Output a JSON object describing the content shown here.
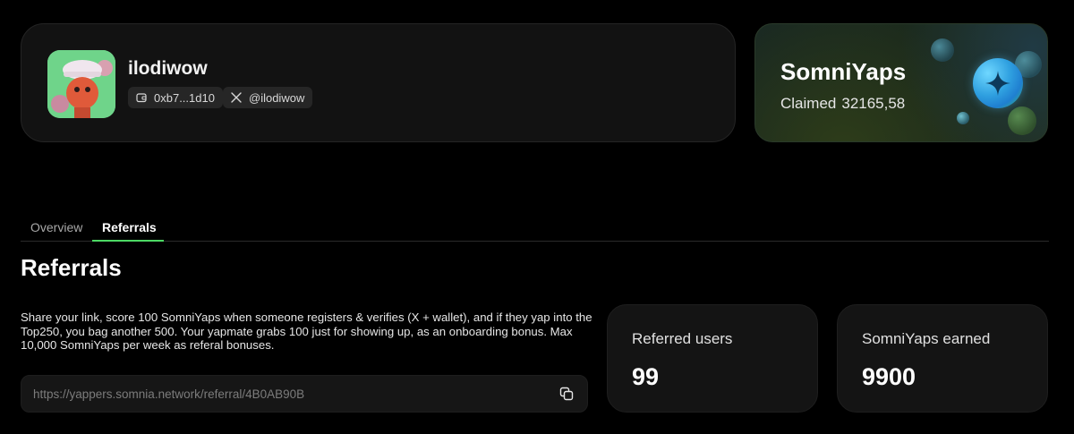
{
  "profile": {
    "username": "ilodiwow",
    "wallet": "0xb7...1d10",
    "x_handle": "@ilodiwow",
    "icons": {
      "wallet": "wallet-icon",
      "x": "x-logo-icon"
    }
  },
  "brand": {
    "title": "SomniYaps",
    "claimed_label": "Claimed",
    "claimed_value": "32165,58",
    "logo": "somnia-sparkle-logo"
  },
  "tabs": [
    {
      "label": "Overview",
      "active": false
    },
    {
      "label": "Referrals",
      "active": true
    }
  ],
  "referrals": {
    "title": "Referrals",
    "description": "Share your link, score 100 SomniYaps when someone registers & verifies (X + wallet), and if they yap into the Top250, you bag another 500. Your yapmate grabs 100 just for showing up, as an onboarding bonus. Max 10,000 SomniYaps per week as referal bonuses.",
    "link": "https://yappers.somnia.network/referral/4B0AB90B",
    "copy_icon": "copy-icon",
    "stats": [
      {
        "label": "Referred users",
        "value": "99"
      },
      {
        "label": "SomniYaps earned",
        "value": "9900"
      }
    ]
  },
  "colors": {
    "accent": "#4cd964",
    "background": "#000000",
    "card": "#121212"
  }
}
